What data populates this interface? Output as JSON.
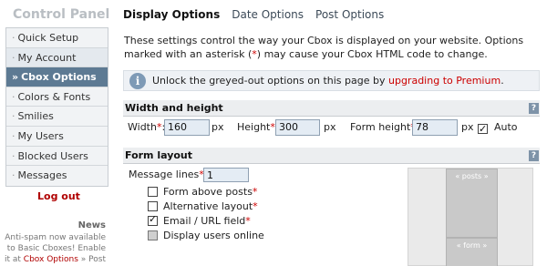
{
  "sidebar": {
    "title": "Control Panel",
    "items": [
      {
        "bullet": "·",
        "label": "Quick Setup"
      },
      {
        "bullet": "·",
        "label": "My Account"
      },
      {
        "bullet": "»",
        "label": "Cbox Options"
      },
      {
        "bullet": "·",
        "label": "Colors & Fonts"
      },
      {
        "bullet": "·",
        "label": "Smilies"
      },
      {
        "bullet": "·",
        "label": "My Users"
      },
      {
        "bullet": "·",
        "label": "Blocked Users"
      },
      {
        "bullet": "·",
        "label": "Messages"
      }
    ],
    "logout": "Log out",
    "news_heading": "News",
    "news_text_1": "Anti-spam now available to Basic Cboxes! Enable it at",
    "news_link": "Cbox Options",
    "news_text_2": "» Post"
  },
  "tabs": [
    "Display Options",
    "Date Options",
    "Post Options"
  ],
  "intro": {
    "text_1": "These settings control the way your Cbox is displayed on your website. Options marked with an asterisk (",
    "asterisk": "*",
    "text_2": ") may cause your Cbox HTML code to change."
  },
  "unlock": {
    "icon": "i",
    "text": "Unlock the greyed-out options on this page by",
    "link": "upgrading to Premium",
    "end": "."
  },
  "width_height": {
    "heading": "Width and height",
    "help": "?",
    "width_label": "Width",
    "width_value": "160",
    "height_label": "Height",
    "height_value": "300",
    "form_height_label": "Form height",
    "form_height_value": "78",
    "unit": "px",
    "auto_label": "Auto",
    "auto_checked": true
  },
  "form_layout": {
    "heading": "Form layout",
    "help": "?",
    "message_lines_label": "Message lines",
    "message_lines_value": "1",
    "options": [
      {
        "label": "Form above posts",
        "required": true,
        "checked": false
      },
      {
        "label": "Alternative layout",
        "required": true,
        "checked": false
      },
      {
        "label": "Email / URL field",
        "required": true,
        "checked": true
      },
      {
        "label": "Display users online",
        "required": false,
        "checked": false,
        "disabled": true
      }
    ],
    "preview_posts": "« posts »",
    "preview_form": "« form »"
  },
  "required_marker": "*",
  "colon": ":"
}
